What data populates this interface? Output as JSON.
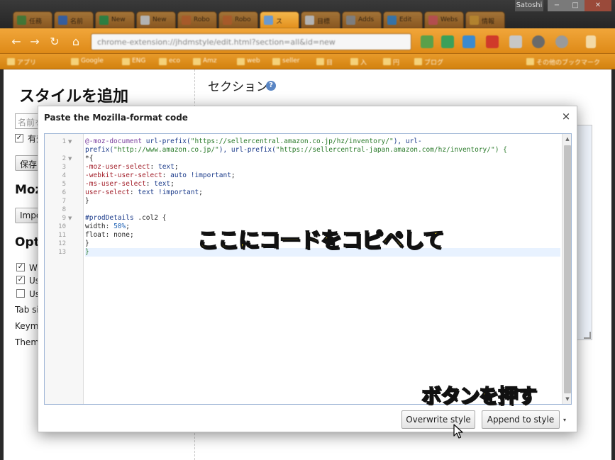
{
  "window": {
    "tabs": [
      {
        "label": "任務",
        "color": "#4a8f3a"
      },
      {
        "label": "名前",
        "color": "#3a6fc4"
      },
      {
        "label": "New",
        "color": "#2e9a4a"
      },
      {
        "label": "New",
        "color": "#e0e0e0"
      },
      {
        "label": "Robo",
        "color": "#d06a2a"
      },
      {
        "label": "Robo",
        "color": "#d06a2a"
      },
      {
        "label": "ス",
        "color": "#6a9ad0"
      },
      {
        "label": "目標",
        "color": "#e0e0e0"
      },
      {
        "label": "Adds",
        "color": "#999999"
      },
      {
        "label": "Edit",
        "color": "#3a8ad0"
      },
      {
        "label": "Webs",
        "color": "#e05a5a"
      },
      {
        "label": "情報",
        "color": "#e0a030"
      }
    ],
    "user_label": "Satoshi",
    "min_label": "−",
    "max_label": "□",
    "close_label": "✕",
    "url": "chrome-extension://jhdmstyle/edit.html?section=all&id=new",
    "bookmarks": [
      "アプリ",
      "Google",
      "ENG",
      "eco",
      "Amz",
      "web",
      "seller",
      "目",
      "入",
      "円",
      "ブログ",
      "その他のブックマーク"
    ]
  },
  "page": {
    "title": "スタイルを追加",
    "name_placeholder": "名前を入力",
    "enabled_label": "有効",
    "save_label": "保存",
    "mozilla_heading": "Mozilla Format",
    "import_label": "Import",
    "options_heading": "Options",
    "option1_label": "Wrap lines",
    "option2_label": "Use smart indent",
    "option3_label": "Use tab",
    "tab_size_label": "Tab size",
    "keymap_label": "Keymap",
    "theme_label": "Theme",
    "section_title": "セクション",
    "help_glyph": "?"
  },
  "modal": {
    "title": "Paste the Mozilla-format code",
    "close_glyph": "×",
    "line_numbers": [
      "1",
      "2",
      "3",
      "4",
      "5",
      "6",
      "7",
      "8",
      "9",
      "10",
      "11",
      "12",
      "13"
    ],
    "code": {
      "l1a_kw": "@-moz-document",
      "l1a_fn1": " url-prefix(",
      "l1a_s1": "\"https://sellercentral.amazon.co.jp/hz/inventory/\"",
      "l1a_fn2": "), url-",
      "l1b_fn": "prefix(",
      "l1b_s1": "\"http://www.amazon.co.jp/\"",
      "l1b_fn2": "), url-prefix(",
      "l1b_s2": "\"https://sellercentral-japan.amazon.com/hz/inventory/\"",
      "l1b_end": ") {",
      "l2": "*{",
      "l3_prop": "-moz-user-select",
      "l3_val": "text",
      "l4_prop": "-webkit-user-select",
      "l4_val": "auto !important",
      "l5_prop": "-ms-user-select",
      "l5_val": "text",
      "l6_prop": "user-select",
      "l6_val": "text !important",
      "l7": "}",
      "l9_sel": "#prodDetails",
      "l9_rest": " .col2 {",
      "l10_prop": "width",
      "l10_val": "50%",
      "l11_prop": "float",
      "l11_val": "none",
      "l12": "}",
      "l13": "}"
    },
    "overwrite_label": "Overwrite style",
    "append_label": "Append to style",
    "menu_arrow": "▾"
  },
  "annotations": {
    "paste_hint": "ここにコードをコピペして",
    "button_hint": "ボタンを押す"
  }
}
